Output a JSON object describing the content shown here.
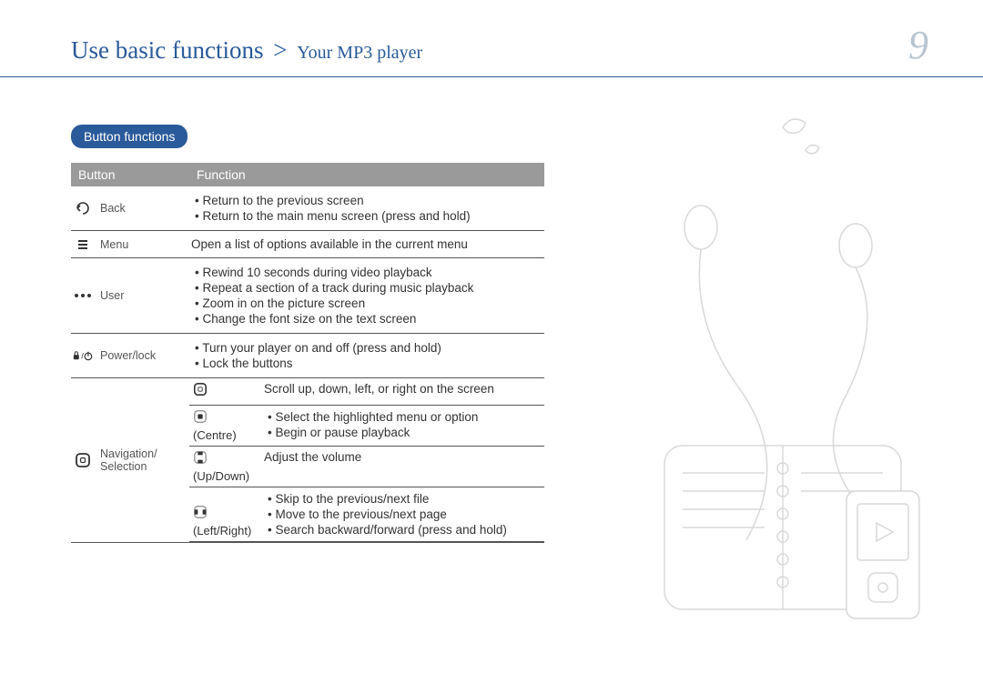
{
  "header": {
    "breadcrumb_main": "Use basic functions",
    "breadcrumb_sep": ">",
    "breadcrumb_sub": "Your MP3 player",
    "page_number": "9"
  },
  "section": {
    "title": "Button functions"
  },
  "table": {
    "head_button": "Button",
    "head_function": "Function",
    "rows": {
      "back": {
        "label": "Back",
        "f1": "Return to the previous screen",
        "f2": "Return to the main menu screen (press and hold)"
      },
      "menu": {
        "label": "Menu",
        "f1": "Open a list of options available in the current menu"
      },
      "user": {
        "label": "User",
        "f1": "Rewind 10 seconds during video playback",
        "f2": "Repeat a section of a track during music playback",
        "f3": "Zoom in on the picture screen",
        "f4": "Change the font size on the text screen"
      },
      "power": {
        "label": "Power/lock",
        "f1": "Turn your player on and off (press and hold)",
        "f2": "Lock the buttons"
      },
      "nav": {
        "label": "Navigation/\nSelection",
        "ring": {
          "f1": "Scroll up, down, left, or right on the screen"
        },
        "centre": {
          "sub": "(Centre)",
          "f1": "Select the highlighted menu or option",
          "f2": "Begin or pause playback"
        },
        "updown": {
          "sub": "(Up/Down)",
          "f1": "Adjust the volume"
        },
        "leftright": {
          "sub": "(Left/Right)",
          "f1": "Skip to the previous/next file",
          "f2": "Move to the previous/next page",
          "f3": "Search backward/forward (press and hold)"
        }
      }
    }
  }
}
